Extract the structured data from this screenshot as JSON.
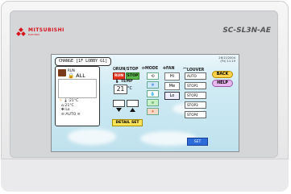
{
  "brand": {
    "name": "MITSUBISHI",
    "sub": "ELECTRIC"
  },
  "model": "SC-SL3N-AE",
  "header": {
    "change": "CHANGE [1F LOBBY G1]",
    "date": "26/11/2004",
    "time": "(Fri) 11:19"
  },
  "unit": {
    "run_label": "RUN",
    "all": "ALL"
  },
  "status": {
    "set_temp": ":21°C",
    "room_temp": ":21°C",
    "fan": ":Lo",
    "louver": ":AUTO"
  },
  "headers": {
    "runstop": "RUN/STOP",
    "mode": "MODE",
    "fan": "FAN",
    "louver": "LOUVER",
    "temp": "TEMP"
  },
  "buttons": {
    "run": "RUN",
    "stop": "STOP",
    "detail": "DETAIL SET",
    "back": "BACK",
    "help": "HELP",
    "set": "SET"
  },
  "temp": {
    "value": "21",
    "unit": "°C"
  },
  "fan": [
    "Hi",
    "Me",
    "Lo"
  ],
  "louver": [
    "AUTO",
    "STOP1",
    "STOP2",
    "STOP3",
    "STOP4"
  ]
}
